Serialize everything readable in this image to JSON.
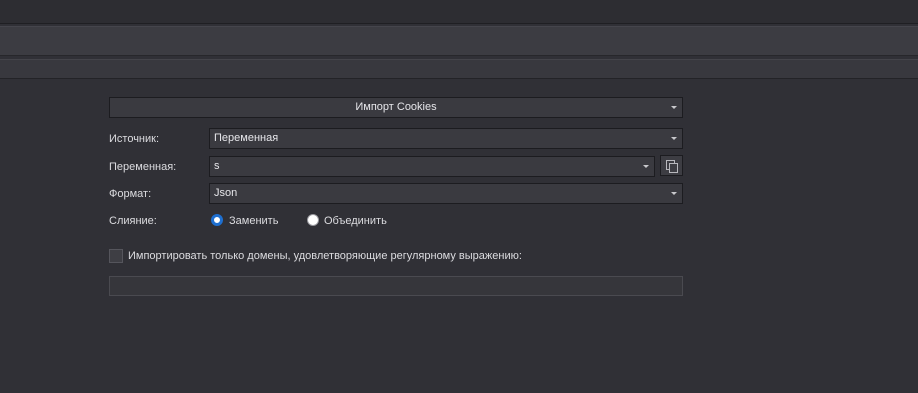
{
  "header": {
    "action_title": "Импорт Cookies"
  },
  "form": {
    "source": {
      "label": "Источник:",
      "value": "Переменная"
    },
    "variable": {
      "label": "Переменная:",
      "value": "s"
    },
    "format": {
      "label": "Формат:",
      "value": "Json"
    },
    "merge": {
      "label": "Слияние:",
      "options": [
        "Заменить",
        "Объединить"
      ],
      "selected": "Заменить"
    },
    "domain_filter": {
      "checkbox_label": "Импортировать только домены, удовлетворяющие регулярному выражению:",
      "checked": false,
      "value": ""
    }
  },
  "colors": {
    "background": "#303036",
    "accent": "#1e6fd0"
  },
  "icons": {
    "copy": "copy-icon",
    "dropdown": "chevron-down-icon"
  }
}
